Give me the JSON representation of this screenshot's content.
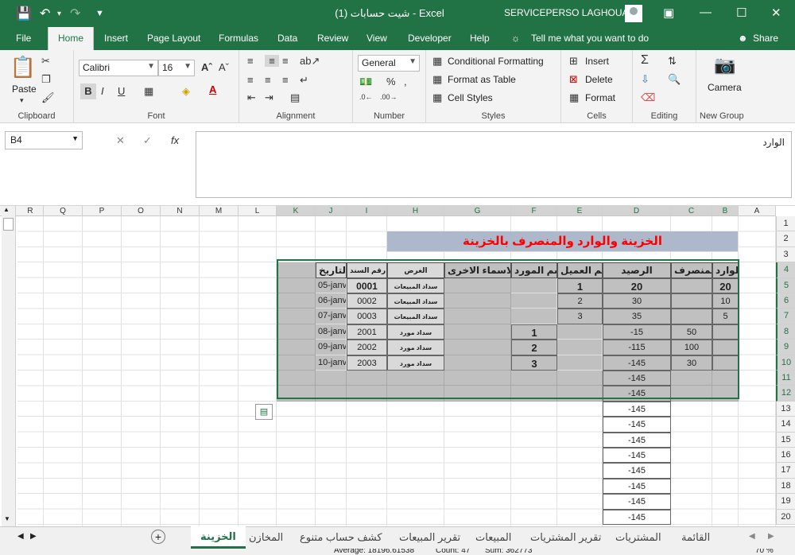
{
  "titlebar": {
    "title": "شيت حسابات (1) - Excel",
    "user": "SERVICEPERSO LAGHOUAT"
  },
  "tabs": [
    "File",
    "Home",
    "Insert",
    "Page Layout",
    "Formulas",
    "Data",
    "Review",
    "View",
    "Developer",
    "Help"
  ],
  "tell_me": "Tell me what you want to do",
  "share": "Share",
  "ribbon": {
    "clipboard": {
      "label": "Clipboard",
      "paste": "Paste"
    },
    "font": {
      "label": "Font",
      "name": "Calibri",
      "size": "16"
    },
    "alignment": {
      "label": "Alignment"
    },
    "number": {
      "label": "Number",
      "format": "General"
    },
    "styles": {
      "label": "Styles",
      "conditional": "Conditional Formatting",
      "table": "Format as Table",
      "cell_styles": "Cell Styles"
    },
    "cells": {
      "label": "Cells",
      "insert": "Insert",
      "delete": "Delete",
      "format": "Format"
    },
    "editing": {
      "label": "Editing"
    },
    "newgroup": {
      "label": "New Group",
      "camera": "Camera"
    }
  },
  "formula": {
    "namebox": "B4",
    "fx": "fx",
    "content": "الوارد"
  },
  "columns": [
    "R",
    "Q",
    "P",
    "O",
    "N",
    "M",
    "L",
    "K",
    "J",
    "I",
    "H",
    "G",
    "F",
    "E",
    "D",
    "C",
    "B",
    "A"
  ],
  "rows": [
    "1",
    "2",
    "3",
    "4",
    "5",
    "6",
    "7",
    "8",
    "9",
    "10",
    "11",
    "12",
    "13",
    "14",
    "15",
    "16",
    "17",
    "18",
    "19",
    "20"
  ],
  "sheet": {
    "title": "الخزينة والوارد والمنصرف بالخزينة",
    "headers": {
      "B": "الوارد",
      "C": "المنصرف",
      "D": "الرصيد",
      "E": "اسم العميل",
      "F": "اسم المورد",
      "G": "الاسماء الاخرى",
      "H": "الغرض",
      "I": "رقم السند",
      "J": "التاريخ"
    },
    "data_rows": [
      {
        "B": "20",
        "C": "",
        "D": "20",
        "E": "1",
        "F": "",
        "H": "سداد المبيعات",
        "I": "0001",
        "J": "05-janv"
      },
      {
        "B": "10",
        "C": "",
        "D": "30",
        "E": "2",
        "F": "",
        "H": "سداد المبيعات",
        "I": "0002",
        "J": "06-janv"
      },
      {
        "B": "5",
        "C": "",
        "D": "35",
        "E": "3",
        "F": "",
        "H": "سداد المبيعات",
        "I": "0003",
        "J": "07-janv"
      },
      {
        "B": "",
        "C": "50",
        "D": "-15",
        "E": "",
        "F": "1",
        "H": "سداد مورد",
        "I": "2001",
        "J": "08-janv"
      },
      {
        "B": "",
        "C": "100",
        "D": "-115",
        "E": "",
        "F": "2",
        "H": "سداد مورد",
        "I": "2002",
        "J": "09-janv"
      },
      {
        "B": "",
        "C": "30",
        "D": "-145",
        "E": "",
        "F": "3",
        "H": "سداد مورد",
        "I": "2003",
        "J": "10-janv"
      }
    ],
    "balance_fill": "-145"
  },
  "sheet_tabs": [
    "الخزينة",
    "المخازن",
    "كشف حساب متنوع",
    "تقرير المبيعات",
    "المبيعات",
    "تقرير المشتريات",
    "المشتريات",
    "القائمة"
  ],
  "status": {
    "average": "Average: 18196.61538",
    "count": "Count: 47",
    "sum": "Sum: 362773",
    "zoom": "70 %"
  },
  "colors": {
    "accent": "#217346",
    "title_band": "#adb9ca",
    "title_text": "#ff0000",
    "selection": "#c0c0c0"
  }
}
